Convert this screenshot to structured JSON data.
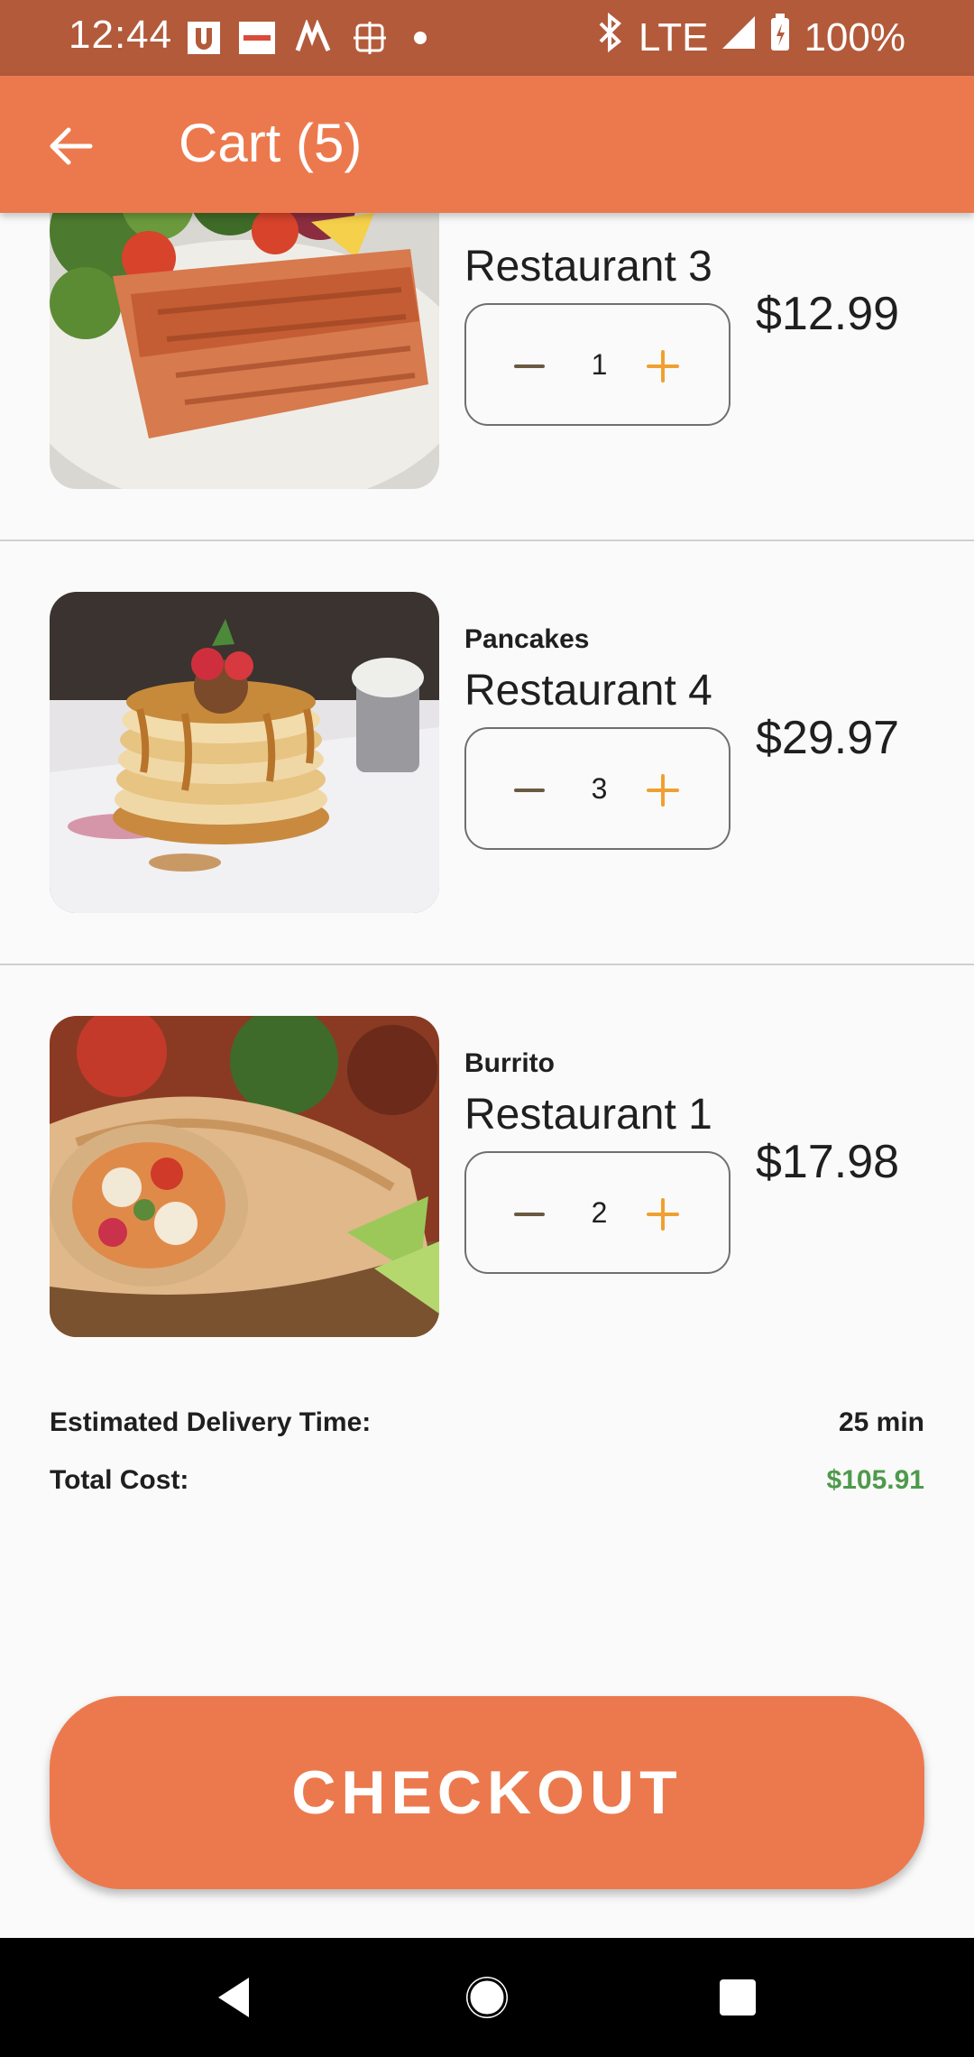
{
  "status_bar": {
    "time": "12:44",
    "network": "LTE",
    "battery": "100%",
    "notification_icons": [
      "u-app-icon",
      "zomato-icon",
      "mobile-app-icon",
      "grid-app-icon",
      "dot-icon"
    ]
  },
  "app_bar": {
    "title": "Cart (5)",
    "back_icon": "arrow-left-icon"
  },
  "cart": {
    "items": [
      {
        "name": "",
        "restaurant": "Restaurant 3",
        "quantity": "1",
        "price": "$12.99",
        "image": "grilled-salmon"
      },
      {
        "name": "Pancakes",
        "restaurant": "Restaurant 4",
        "quantity": "3",
        "price": "$29.97",
        "image": "pancake-stack"
      },
      {
        "name": "Burrito",
        "restaurant": "Restaurant 1",
        "quantity": "2",
        "price": "$17.98",
        "image": "burrito"
      }
    ]
  },
  "summary": {
    "delivery_label": "Estimated Delivery Time:",
    "delivery_value": "25 min",
    "total_label": "Total Cost:",
    "total_value": "$105.91"
  },
  "checkout_label": "CHECKOUT",
  "colors": {
    "status_bar": "#b35a3b",
    "primary": "#ec794d",
    "plus": "#f0a032",
    "total_green": "#4e9a4c"
  }
}
